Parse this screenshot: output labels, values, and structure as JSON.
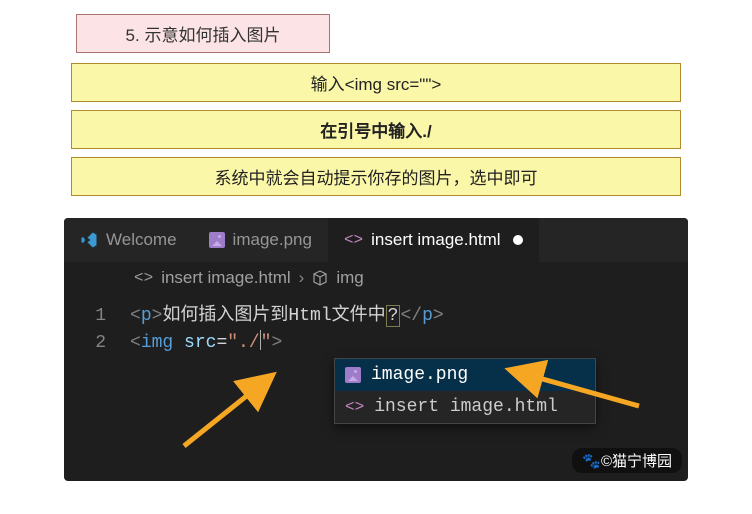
{
  "header": {
    "title": "5. 示意如何插入图片"
  },
  "steps": [
    {
      "text": "输入<img src=\"\">",
      "bold": false
    },
    {
      "text": "在引号中输入./",
      "bold": true
    },
    {
      "text": "系统中就会自动提示你存的图片，选中即可",
      "bold": false
    }
  ],
  "editor": {
    "tabs": [
      {
        "id": "welcome",
        "label": "Welcome",
        "icon": "vscode-icon",
        "active": false
      },
      {
        "id": "image",
        "label": "image.png",
        "icon": "image-icon",
        "active": false
      },
      {
        "id": "insert",
        "label": "insert image.html",
        "icon": "code-icon",
        "active": true,
        "dirty": true
      }
    ],
    "breadcrumb": {
      "file": "insert image.html",
      "symbol": "img"
    },
    "code": {
      "lines": [
        {
          "num": "1",
          "segments": [
            {
              "t": "<",
              "c": "tag-bracket"
            },
            {
              "t": "p",
              "c": "tag-name"
            },
            {
              "t": ">",
              "c": "tag-bracket"
            },
            {
              "t": "如何插入图片到Html文件中",
              "c": "text"
            },
            {
              "t": "?",
              "c": "text qmark-box"
            },
            {
              "t": "<",
              "c": "tag-bracket"
            },
            {
              "t": "/",
              "c": "tag-bracket"
            },
            {
              "t": "p",
              "c": "tag-name"
            },
            {
              "t": ">",
              "c": "tag-bracket"
            }
          ]
        },
        {
          "num": "2",
          "segments": [
            {
              "t": "<",
              "c": "tag-bracket"
            },
            {
              "t": "img",
              "c": "tag-name"
            },
            {
              "t": " ",
              "c": "text"
            },
            {
              "t": "src",
              "c": "attr-name"
            },
            {
              "t": "=",
              "c": "text"
            },
            {
              "t": "\"./",
              "c": "string"
            },
            {
              "t": "|",
              "c": "cursor",
              "cursor": true
            },
            {
              "t": "\"",
              "c": "string"
            },
            {
              "t": ">",
              "c": "tag-bracket"
            }
          ]
        }
      ]
    },
    "suggest": {
      "items": [
        {
          "label": "image.png",
          "icon": "image-icon",
          "selected": true
        },
        {
          "label": "insert image.html",
          "icon": "code-icon",
          "selected": false
        }
      ]
    }
  },
  "watermark": "🐾©猫宁博园"
}
